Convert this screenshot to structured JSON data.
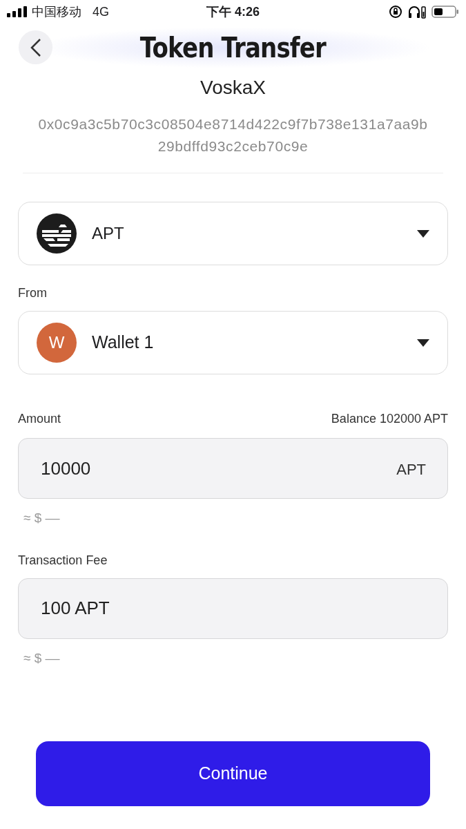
{
  "status_bar": {
    "carrier": "中国移动",
    "network": "4G",
    "time": "下午 4:26"
  },
  "header": {
    "title": "Token Transfer"
  },
  "recipient": {
    "name": "VoskaX",
    "address_lines": [
      "0x0c9a3c5b70c3c08504e8714d422c9f7b738e131a7aa9b",
      "29bdffd93c2ceb70c9e"
    ]
  },
  "token_select": {
    "label": "APT"
  },
  "from": {
    "label": "From",
    "wallet": {
      "initial": "W",
      "name": "Wallet 1",
      "color": "#d2673c"
    }
  },
  "amount": {
    "label": "Amount",
    "balance": "Balance 102000 APT",
    "value": "10000",
    "unit": "APT",
    "fiat": "≈ $ ––"
  },
  "fee": {
    "label": "Transaction Fee",
    "value": "100 APT",
    "fiat": "≈ $ ––"
  },
  "continue_button": "Continue"
}
